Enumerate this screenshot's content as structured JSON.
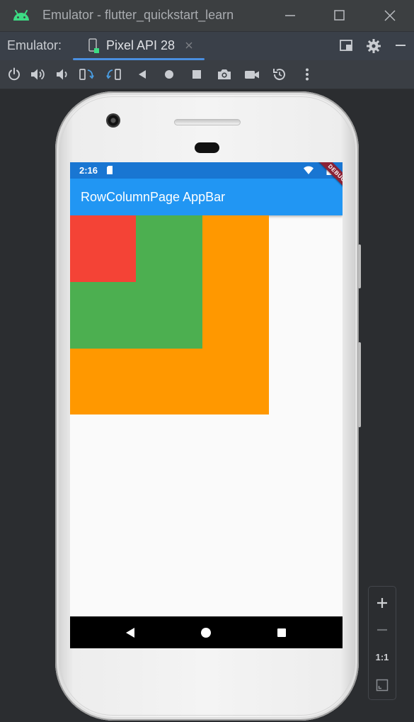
{
  "window": {
    "title": "Emulator - flutter_quickstart_learn"
  },
  "tool_window": {
    "label": "Emulator:",
    "device_tab": "Pixel API 28"
  },
  "toolbar_icons": [
    "power-icon",
    "volume-up-icon",
    "volume-down-icon",
    "rotate-left-icon",
    "rotate-right-icon",
    "back-icon",
    "home-icon",
    "overview-icon",
    "camera-icon",
    "record-icon",
    "snapshot-icon",
    "more-icon"
  ],
  "device": {
    "status_time": "2:16",
    "app_bar_title": "RowColumnPage AppBar",
    "debug_banner": "DEBUG",
    "colors": {
      "status_bar": "#1976d2",
      "app_bar": "#2196f3",
      "orange_box": "#ff9800",
      "green_box": "#4caf50",
      "red_box": "#f44336"
    }
  },
  "zoom": {
    "actual_size_label": "1:1"
  }
}
